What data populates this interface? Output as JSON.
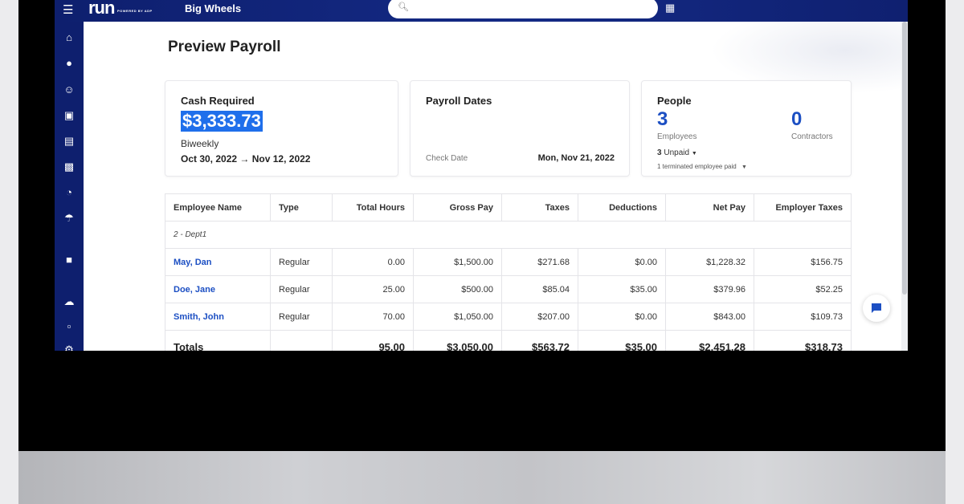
{
  "app": {
    "logo": "run",
    "logo_sub": "POWERED BY ADP",
    "company": "Big Wheels"
  },
  "search": {
    "placeholder": ""
  },
  "sidebar": {
    "icons": [
      "home-icon",
      "dollar-icon",
      "people-icon",
      "payroll-icon",
      "documents-icon",
      "time-icon",
      "timer-icon",
      "umbrella-icon",
      "piggy-bank-icon",
      "cloud-lock-icon",
      "file-icon",
      "settings-icon"
    ]
  },
  "page": {
    "title": "Preview Payroll"
  },
  "cash": {
    "title": "Cash Required",
    "amount": "$3,333.73",
    "frequency": "Biweekly",
    "period_start": "Oct 30, 2022",
    "arrow": "→",
    "period_end": "Nov 12, 2022"
  },
  "dates": {
    "title": "Payroll Dates",
    "check_label": "Check Date",
    "check_value": "Mon, Nov 21, 2022"
  },
  "people": {
    "title": "People",
    "employees_count": "3",
    "employees_label": "Employees",
    "contractors_count": "0",
    "contractors_label": "Contractors",
    "unpaid_count": "3",
    "unpaid_label": "Unpaid",
    "terminated": "1 terminated employee paid"
  },
  "table": {
    "headers": [
      "Employee Name",
      "Type",
      "Total Hours",
      "Gross Pay",
      "Taxes",
      "Deductions",
      "Net Pay",
      "Employer Taxes"
    ],
    "group": "2 - Dept1",
    "rows": [
      [
        "May, Dan",
        "Regular",
        "0.00",
        "$1,500.00",
        "$271.68",
        "$0.00",
        "$1,228.32",
        "$156.75"
      ],
      [
        "Doe, Jane",
        "Regular",
        "25.00",
        "$500.00",
        "$85.04",
        "$35.00",
        "$379.96",
        "$52.25"
      ],
      [
        "Smith, John",
        "Regular",
        "70.00",
        "$1,050.00",
        "$207.00",
        "$0.00",
        "$843.00",
        "$109.73"
      ]
    ],
    "totals": [
      "Totals",
      "",
      "95.00",
      "$3,050.00",
      "$563.72",
      "$35.00",
      "$2,451.28",
      "$318.73"
    ]
  },
  "colors": {
    "nav": "#0e1f6e",
    "link": "#1c4fc3",
    "highlight": "#1f6feb"
  }
}
